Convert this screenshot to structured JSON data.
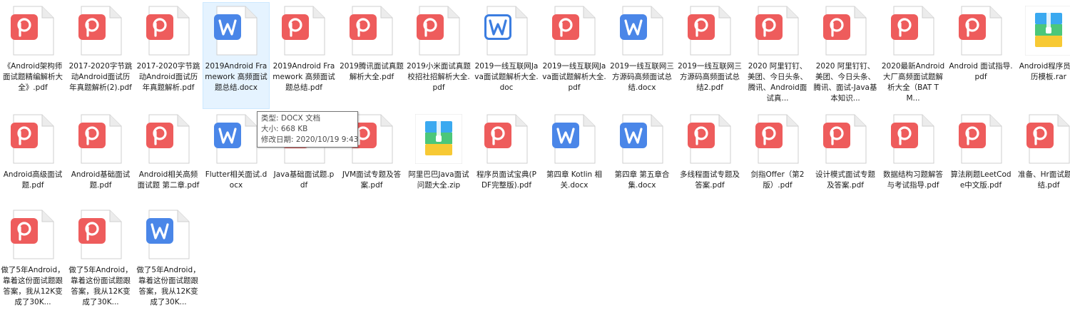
{
  "colors": {
    "pdf_accent": "#ee5c5c",
    "word_accent": "#4a86e8",
    "word_outline_accent": "#3b7de0",
    "selection_bg": "#e5f3ff"
  },
  "files": [
    {
      "name": "《Android架构师面试题精编解析大全》.pdf",
      "type": "pdf",
      "icon": "pdf-icon"
    },
    {
      "name": "2017-2020字节跳动Android面试历年真题解析(2).pdf",
      "type": "pdf",
      "icon": "pdf-icon"
    },
    {
      "name": "2017-2020字节跳动Android面试历年真题解析.pdf",
      "type": "pdf",
      "icon": "pdf-icon"
    },
    {
      "name": "2019Android Framework 高频面试题总结.docx",
      "type": "docx",
      "icon": "word-icon",
      "selected": true
    },
    {
      "name": "2019Android Framework 高频面试题总结.pdf",
      "type": "pdf",
      "icon": "pdf-icon"
    },
    {
      "name": "2019腾讯面试真题解析大全.pdf",
      "type": "pdf",
      "icon": "pdf-icon"
    },
    {
      "name": "2019小米面试真题校招社招解析大全.pdf",
      "type": "pdf",
      "icon": "pdf-icon"
    },
    {
      "name": "2019一线互联网Java面试题解析大全.doc",
      "type": "doc",
      "icon": "word-outline-icon"
    },
    {
      "name": "2019一线互联网Java面试题解析大全.pdf",
      "type": "pdf",
      "icon": "pdf-icon"
    },
    {
      "name": "2019一线互联网三方源码高频面试总结.docx",
      "type": "docx",
      "icon": "word-icon"
    },
    {
      "name": "2019一线互联网三方源码高频面试总结2.pdf",
      "type": "pdf",
      "icon": "pdf-icon"
    },
    {
      "name": "2020 阿里钉钉、美团、今日头条、腾讯、Android面试真...",
      "type": "pdf",
      "icon": "pdf-icon"
    },
    {
      "name": "2020 阿里钉钉、美团、今日头条、腾讯、面试-Java基本知识...",
      "type": "pdf",
      "icon": "pdf-icon"
    },
    {
      "name": "2020最新Android大厂高频面试题解析大全（BAT TM...",
      "type": "pdf",
      "icon": "pdf-icon"
    },
    {
      "name": "Android 面试指导.pdf",
      "type": "pdf",
      "icon": "pdf-icon"
    },
    {
      "name": "Android程序员简历模板.rar",
      "type": "rar",
      "icon": "archive-icon"
    },
    {
      "name": "Android高级面试题.pdf",
      "type": "pdf",
      "icon": "pdf-icon"
    },
    {
      "name": "Android基础面试题.pdf",
      "type": "pdf",
      "icon": "pdf-icon"
    },
    {
      "name": "Android相关高频面试题 第二章.pdf",
      "type": "pdf",
      "icon": "pdf-icon"
    },
    {
      "name": "Flutter相关面试.docx",
      "type": "docx",
      "icon": "word-icon"
    },
    {
      "name": "Java基础面试题.pdf",
      "type": "pdf",
      "icon": "pdf-icon"
    },
    {
      "name": "JVM面试专题及答案.pdf",
      "type": "pdf",
      "icon": "pdf-icon"
    },
    {
      "name": "阿里巴巴Java面试问题大全.zip",
      "type": "zip",
      "icon": "archive-icon"
    },
    {
      "name": "程序员面试宝典(PDF完整版).pdf",
      "type": "pdf",
      "icon": "pdf-icon"
    },
    {
      "name": "第四章 Kotlin 相关.docx",
      "type": "docx",
      "icon": "word-icon"
    },
    {
      "name": "第四章 第五章合集.docx",
      "type": "docx",
      "icon": "word-icon"
    },
    {
      "name": "多线程面试专题及答案.pdf",
      "type": "pdf",
      "icon": "pdf-icon"
    },
    {
      "name": "剑指Offer（第2版）.pdf",
      "type": "pdf",
      "icon": "pdf-icon"
    },
    {
      "name": "设计模式面试专题及答案.pdf",
      "type": "pdf",
      "icon": "pdf-icon"
    },
    {
      "name": "数据结构习题解答与考试指导.pdf",
      "type": "pdf",
      "icon": "pdf-icon"
    },
    {
      "name": "算法刷题LeetCode中文版.pdf",
      "type": "pdf",
      "icon": "pdf-icon"
    },
    {
      "name": "准备、Hr面试题总结.pdf",
      "type": "pdf",
      "icon": "pdf-icon"
    },
    {
      "name": "做了5年Android，靠着这份面试题跟答案，我从12K变成了30K...",
      "type": "pdf",
      "icon": "pdf-icon"
    },
    {
      "name": "做了5年Android，靠着这份面试题跟答案，我从12K变成了30K...",
      "type": "pdf",
      "icon": "pdf-icon"
    },
    {
      "name": "做了5年Android，靠着这份面试题跟答案，我从12K变成了30K...",
      "type": "docx",
      "icon": "word-icon"
    }
  ],
  "tooltip": {
    "type_line": "类型: DOCX 文档",
    "size_line": "大小: 668 KB",
    "date_line": "修改日期: 2020/10/19 9:43"
  }
}
